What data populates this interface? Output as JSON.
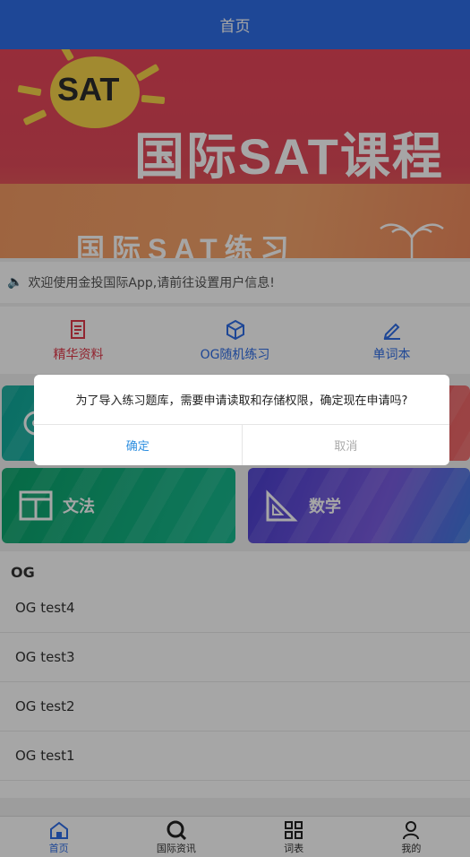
{
  "header": {
    "title": "首页"
  },
  "banner": {
    "badge": "SAT",
    "title": "国际SAT课程",
    "subtitle": "国际SAT练习"
  },
  "notice": {
    "text": "欢迎使用金投国际App,请前往设置用户信息!"
  },
  "menu": {
    "items": [
      {
        "label": "精华资料",
        "color": "#e03a4a"
      },
      {
        "label": "OG随机练习",
        "color": "#2f6de6"
      },
      {
        "label": "单词本",
        "color": "#2f6de6"
      }
    ]
  },
  "cards": [
    {
      "label": "",
      "color": "#17b3a8"
    },
    {
      "label": "",
      "color": "#e8455a"
    },
    {
      "label": "文法",
      "color": "#10b080"
    },
    {
      "label": "数学",
      "color": "#5a4fd8"
    }
  ],
  "og": {
    "title": "OG",
    "items": [
      "OG test4",
      "OG test3",
      "OG test2",
      "OG test1"
    ]
  },
  "tabbar": {
    "items": [
      {
        "label": "首页",
        "icon": "home-icon",
        "active": true
      },
      {
        "label": "国际资讯",
        "icon": "search-icon",
        "active": false
      },
      {
        "label": "词表",
        "icon": "grid-icon",
        "active": false
      },
      {
        "label": "我的",
        "icon": "user-icon",
        "active": false
      }
    ]
  },
  "dialog": {
    "message": "为了导入练习题库，需要申请读取和存储权限，确定现在申请吗?",
    "confirm": "确定",
    "cancel": "取消"
  },
  "colors": {
    "primary": "#2f6de6",
    "accent_red": "#e03a4a"
  }
}
